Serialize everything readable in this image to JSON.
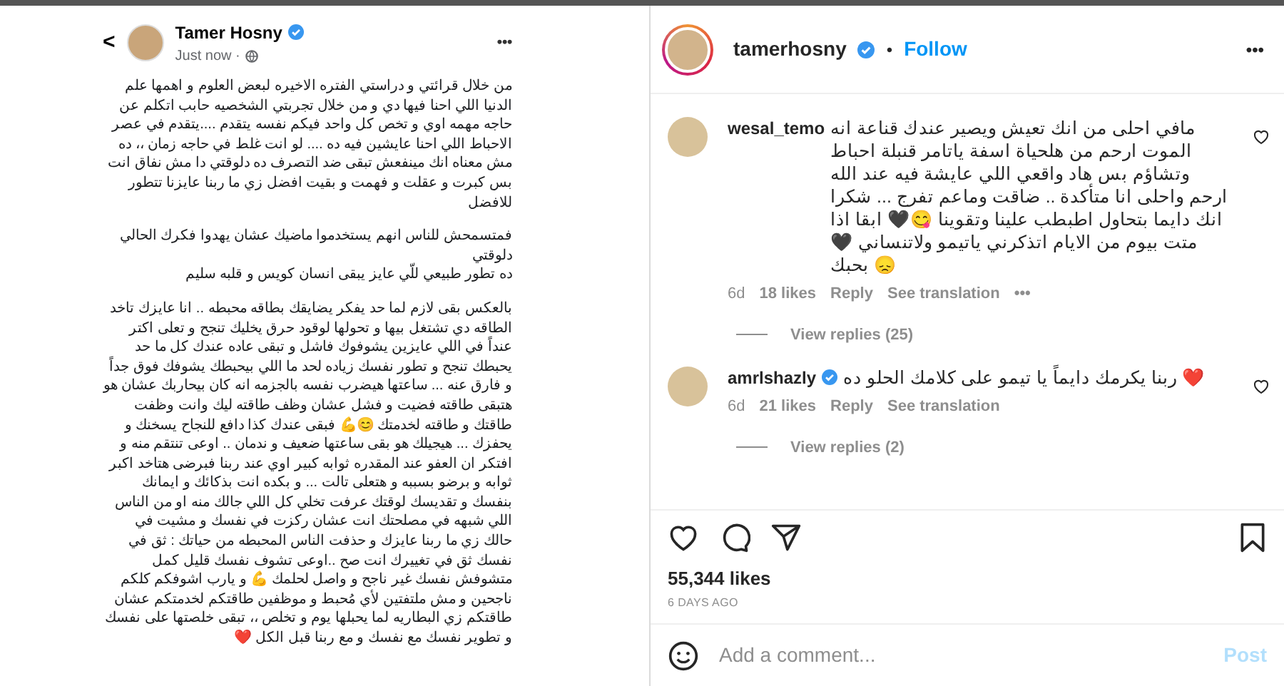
{
  "facebook_post": {
    "back": "<",
    "author": "Tamer Hosny",
    "verified": true,
    "time": "Just now ·",
    "more": "•••",
    "paragraphs": [
      {
        "lines": [
          "من خلال قرائتي و دراستي الفتره الاخيره لبعض العلوم و اهمها علم الدنيا اللي احنا فيها دي و من خلال تجربتي الشخصيه  حابب اتكلم عن حاجه مهمه اوي و تخص كل واحد فيكم نفسه يتقدم ....يتقدم في عصر الاحباط اللي احنا عايشين فيه ده .... لو انت غلط في حاجه زمان ،، ده مش معناه انك مينفعش تبقى ضد التصرف ده دلوقتي  دا مش نفاق انت بس كبرت و عقلت و فهمت و بقيت افضل زي ما ربنا عايزنا تتطور للافضل"
        ]
      },
      {
        "lines": [
          "فمتسمحش للناس انهم يستخدموا ماضيك عشان يهدوا فكرك الحالي دلوقتي",
          "ده تطور طبيعي للّي عايز يبقى انسان كويس و قلبه سليم"
        ]
      },
      {
        "lines": [
          "بالعكس بقى لازم لما حد يفكر يضايقك بطاقه محبطه .. انا عايزك تاخد الطاقه دي  تشتغل بيها و تحولها لوقود حرق يخليك تنجح و تعلى اكتر عنداً في اللي عايزين يشوفوك فاشل و تبقى عاده عندك كل ما حد يحبطك تنجح و تطور نفسك زياده لحد ما اللي بيحبطك يشوفك فوق جداً  و فارق عنه ... ساعتها هيضرب نفسه بالجزمه انه كان بيحاربك عشان هو هتبقى طاقته فضيت و فشل عشان وظف طاقته ليك وانت وظفت طاقتك و طاقته لخدمتك 😊💪 فبقى عندك كذا دافع للنجاح يسخنك و يحفزك ... هيجيلك هو بقى ساعتها ضعيف و ندمان .. اوعى تنتقم منه و افتكر ان العفو عند المقدره ثوابه كبير اوي عند ربنا فبرضى هتاخد اكبر ثوابه و برضو بسببه و هتعلى تالت ... و بكده انت بذكائك و ايمانك بنفسك و تقديسك لوقتك عرفت تخلي كل اللي جالك منه او من الناس اللي شبهه في مصلحتك انت   عشان ركزت في نفسك و مشيت في حالك زي ما ربنا عايزك و حذفت الناس المحبطه من حياتك : ثق في نفسك ثق في تغييرك انت صح  ..اوعى تشوف نفسك قليل كمل متشوفش نفسك غير ناجح و واصل لحلمك 💪 و يارب اشوفكم كلكم ناجحين و مش ملتفتين لأي مُحبط و موظفين طاقتكم لخدمتكم عشان طاقتكم زي البطاريه لما يحبلها يوم و تخلص  ،، تبقى خلصتها على نفسك و تطوير نفسك مع نفسك و مع ربنا قبل الكل ❤️"
        ]
      }
    ]
  },
  "instagram": {
    "username": "tamerhosny",
    "verified": true,
    "separator": "•",
    "follow": "Follow",
    "more": "•••",
    "comments": [
      {
        "username": "wesal_temo",
        "verified": false,
        "text": "مافي احلى من انك تعيش ويصير عندك قناعة انه الموت ارحم من هلحياة اسفة ياتامر قنبلة احباط وتشاؤم بس هاد واقعي اللي عايشة فيه عند الله ارحم واحلى انا متأكدة .. ضاقت وماعم تفرج ... شكرا انك دايما بتحاول اطبطب علينا وتقوينا 😋🖤 ابقا اذا متت بيوم من الايام اتذكرني ياتيمو ولاتنساني 🖤 بحبك 😞",
        "time": "6d",
        "likes": "18 likes",
        "reply": "Reply",
        "translation": "See translation",
        "more": "•••",
        "view_replies": "View replies (25)"
      },
      {
        "username": "amrlshazly",
        "verified": true,
        "text": "ربنا يكرمك دايماً يا تيمو على كلامك الحلو ده ❤️",
        "time": "6d",
        "likes": "21 likes",
        "reply": "Reply",
        "translation": "See translation",
        "view_replies": "View replies (2)"
      }
    ],
    "liked": false,
    "saved": false,
    "likes": "55,344 likes",
    "date": "6 DAYS AGO",
    "comment_field": {
      "placeholder": "Add a comment..."
    },
    "post_button": {
      "label": "Post",
      "disabled": true
    }
  }
}
